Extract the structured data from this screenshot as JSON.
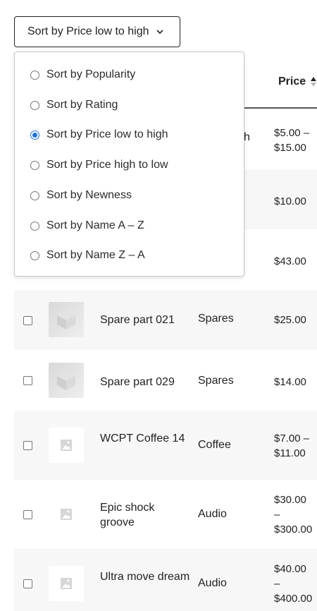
{
  "sort": {
    "label": "Sort by Price low to high",
    "options": [
      {
        "label": "Sort by Popularity",
        "selected": false
      },
      {
        "label": "Sort by Rating",
        "selected": false
      },
      {
        "label": "Sort by Price low to high",
        "selected": true
      },
      {
        "label": "Sort by Price high to low",
        "selected": false
      },
      {
        "label": "Sort by Newness",
        "selected": false
      },
      {
        "label": "Sort by Name A – Z",
        "selected": false
      },
      {
        "label": "Sort by Name Z – A",
        "selected": false
      }
    ]
  },
  "table": {
    "price_header": "Price",
    "partial_cells": {
      "row0_cat_tail": "h",
      "row0_price_line1": "$5.00 –",
      "row0_price_line2": "$15.00",
      "row1_price": "$10.00",
      "row2_price": "$43.00"
    },
    "rows": [
      {
        "name": "Spare part 021",
        "category": "Spares",
        "price_line1": "$25.00",
        "price_line2": "",
        "price_line3": "",
        "thumb": "cube-image"
      },
      {
        "name": "Spare part 029",
        "category": "Spares",
        "price_line1": "$14.00",
        "price_line2": "",
        "price_line3": "",
        "thumb": "cube-image"
      },
      {
        "name": "WCPT Coffee 14",
        "category": "Coffee",
        "price_line1": "$7.00 –",
        "price_line2": "$11.00",
        "price_line3": "",
        "thumb": "placeholder-image"
      },
      {
        "name": "Epic shock groove",
        "category": "Audio",
        "price_line1": "$30.00",
        "price_line2": "–",
        "price_line3": "$300.00",
        "thumb": "placeholder-image"
      },
      {
        "name": "Ultra move dream",
        "category": "Audio",
        "price_line1": "$40.00",
        "price_line2": "–",
        "price_line3": "$400.00",
        "thumb": "placeholder-image"
      }
    ]
  },
  "colors": {
    "accent": "#1a73e8",
    "row_shade": "#f7f7f7",
    "border": "#555555"
  }
}
